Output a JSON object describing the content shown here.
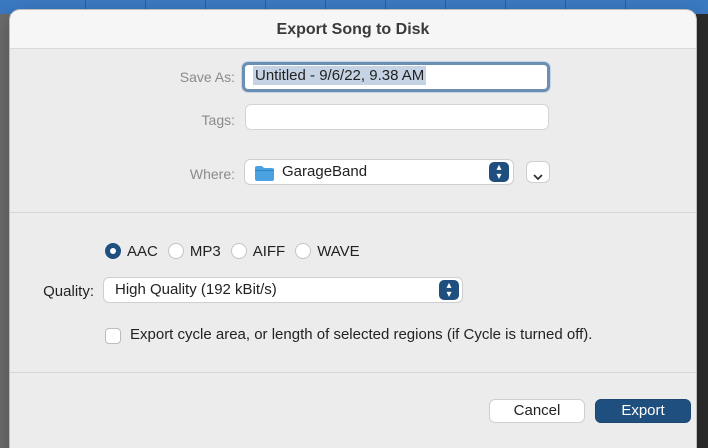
{
  "dialog": {
    "title": "Export Song to Disk"
  },
  "form": {
    "save_as_label": "Save As:",
    "save_as_value": "Untitled - 9/6/22, 9.38 AM",
    "tags_label": "Tags:",
    "tags_value": "",
    "where_label": "Where:",
    "where_value": "GarageBand"
  },
  "format": {
    "options": [
      "AAC",
      "MP3",
      "AIFF",
      "WAVE"
    ],
    "selected": "AAC"
  },
  "quality": {
    "label": "Quality:",
    "value": "High Quality (192 kBit/s)"
  },
  "cycle_option": {
    "label": "Export cycle area, or length of selected regions (if Cycle is turned off).",
    "checked": false
  },
  "buttons": {
    "cancel_label": "Cancel",
    "export_label": "Export"
  },
  "colors": {
    "accent": "#1e4f7e",
    "folder": "#4aa3e0"
  },
  "icons": {
    "folder": "folder-icon",
    "stepper": "up-down-stepper-icon",
    "chevron": "chevron-down-icon"
  }
}
